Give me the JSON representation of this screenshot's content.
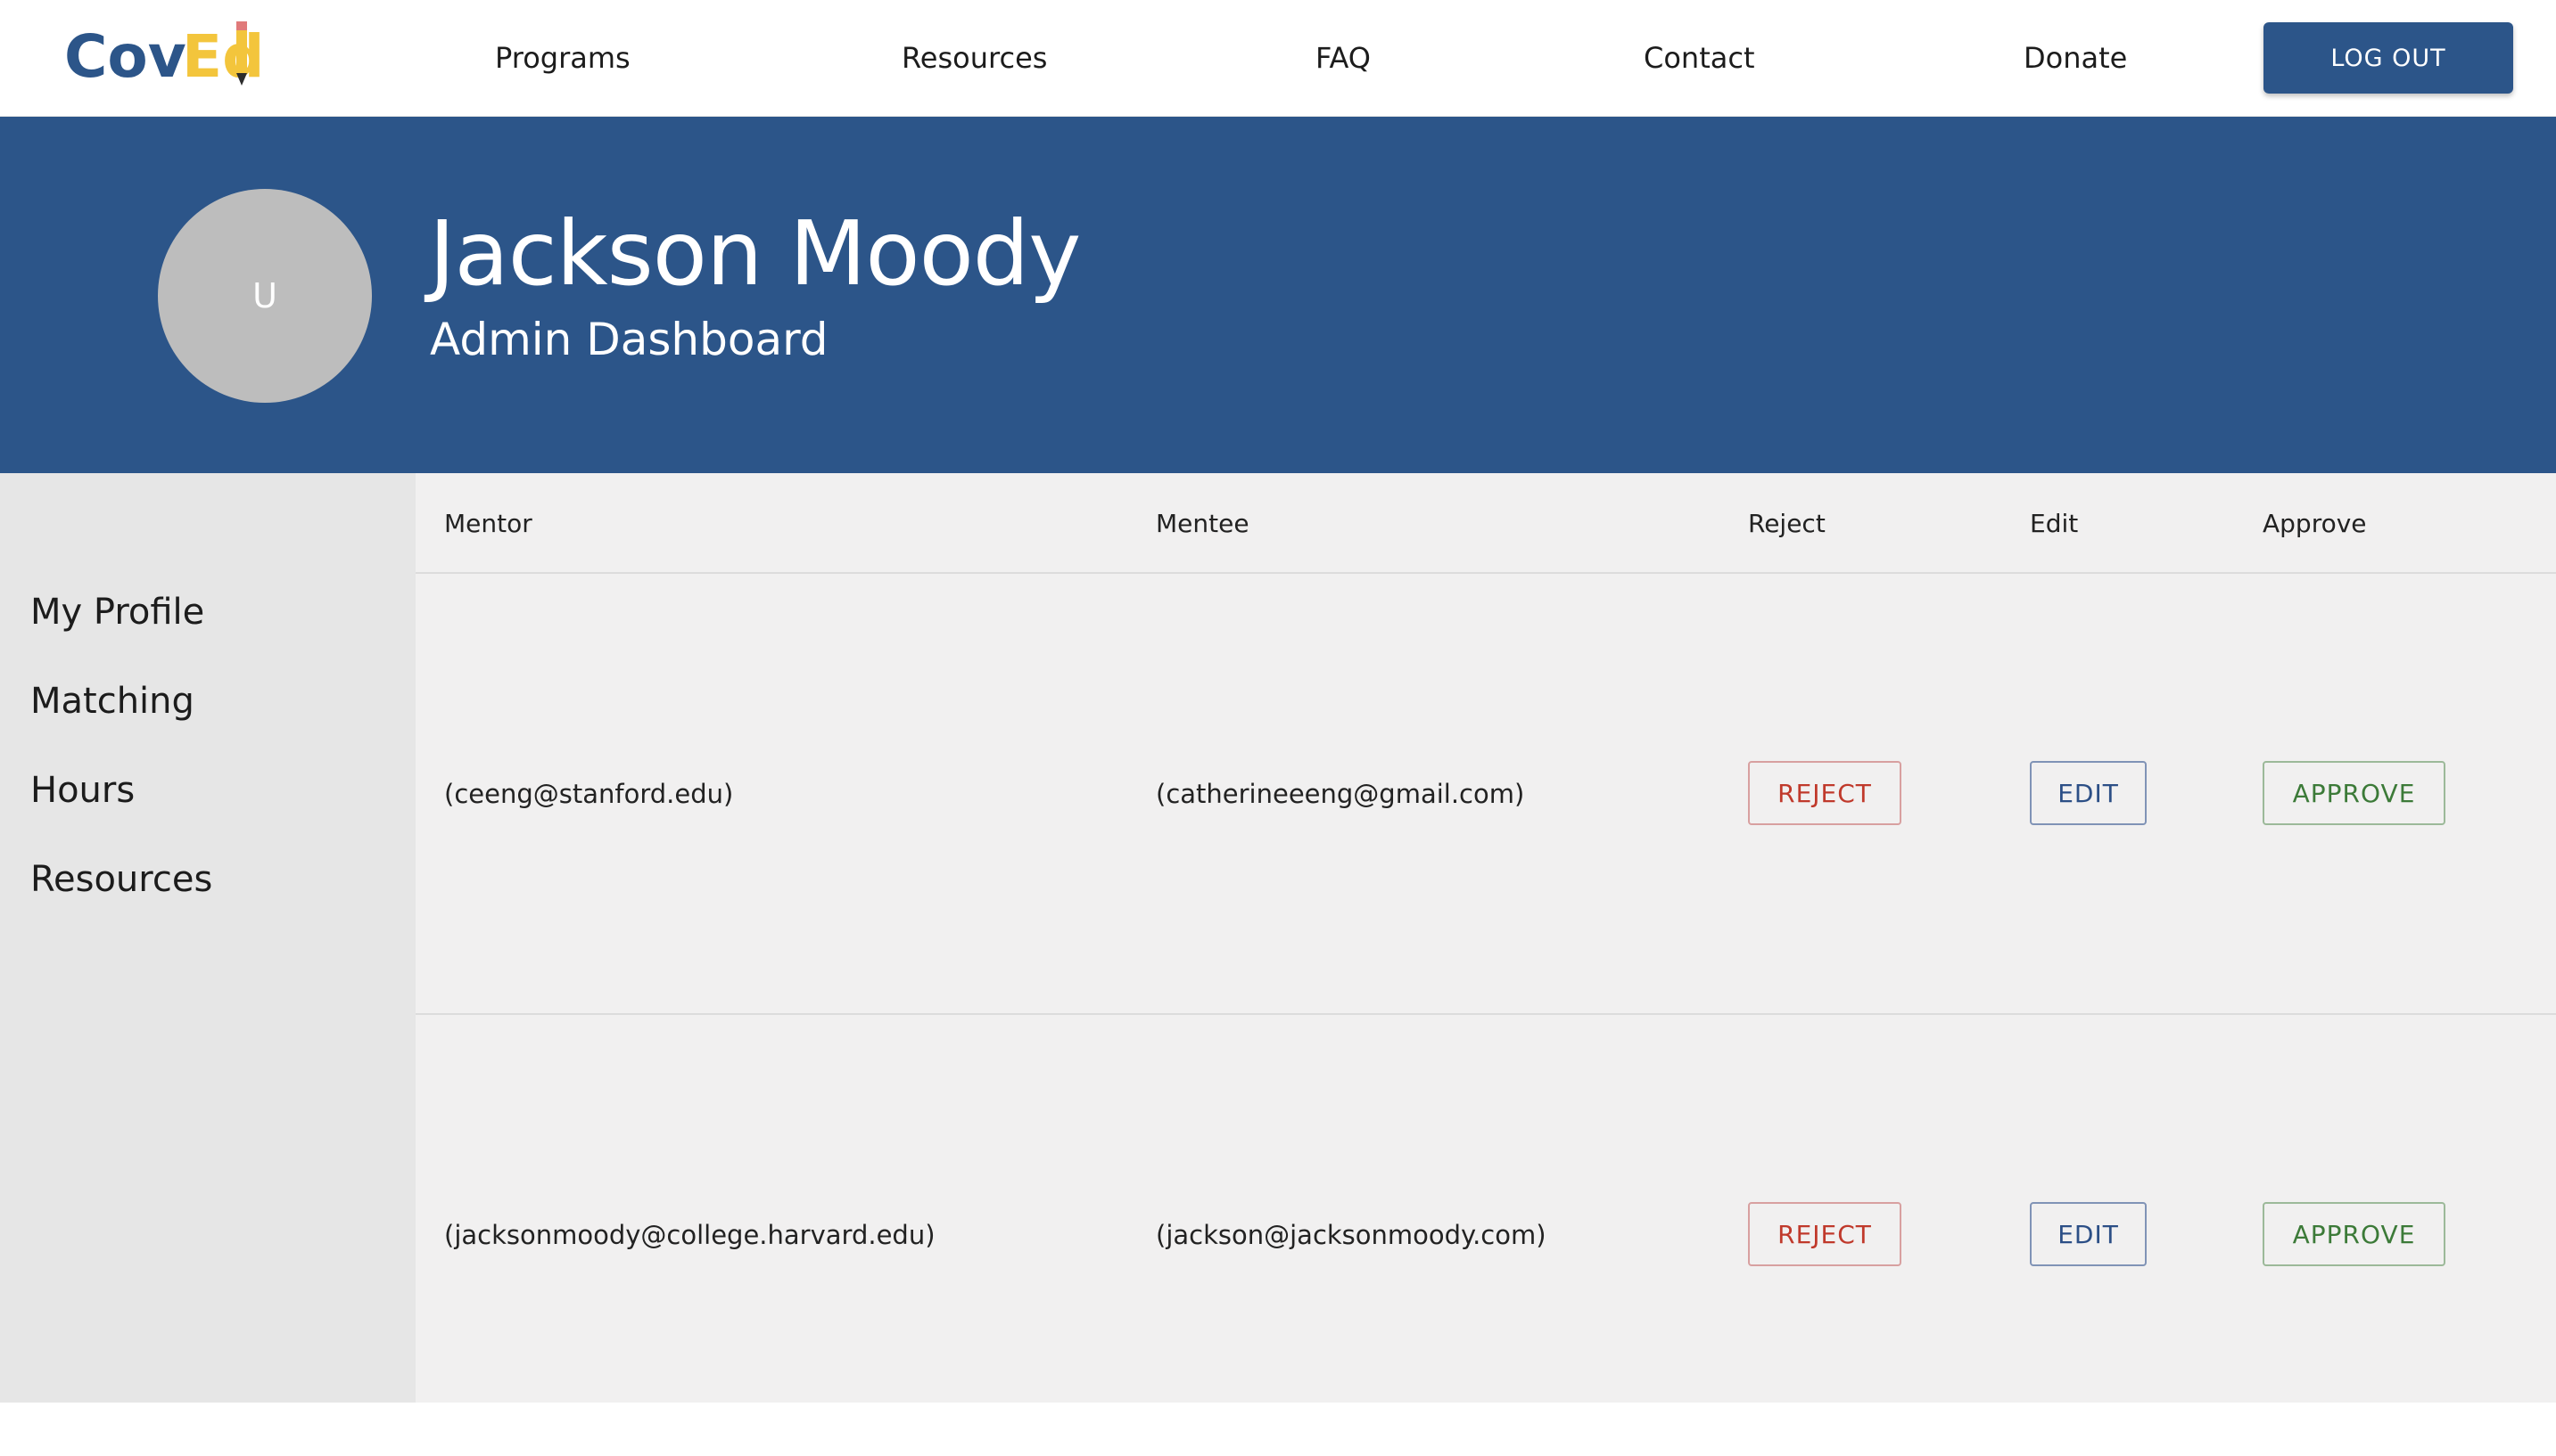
{
  "nav": {
    "logo_text_left": "Cov",
    "logo_text_right": "Ed",
    "links": [
      "Programs",
      "Resources",
      "FAQ",
      "Contact",
      "Donate"
    ],
    "logout_label": "LOG OUT"
  },
  "profile": {
    "avatar_initial": "U",
    "name": "Jackson Moody",
    "role": "Admin Dashboard"
  },
  "sidebar": {
    "items": [
      "My Profile",
      "Matching",
      "Hours",
      "Resources"
    ]
  },
  "table": {
    "headers": {
      "mentor": "Mentor",
      "mentee": "Mentee",
      "reject": "Reject",
      "edit": "Edit",
      "approve": "Approve"
    },
    "rows": [
      {
        "mentor": "(ceeng@stanford.edu)",
        "mentee": "(catherineeeng@gmail.com)",
        "reject_label": "REJECT",
        "edit_label": "EDIT",
        "approve_label": "APPROVE"
      },
      {
        "mentor": "(jacksonmoody@college.harvard.edu)",
        "mentee": "(jackson@jacksonmoody.com)",
        "reject_label": "REJECT",
        "edit_label": "EDIT",
        "approve_label": "APPROVE"
      }
    ]
  },
  "colors": {
    "brand_blue": "#2c5589",
    "logo_yellow": "#f3c53c",
    "reject_red": "#c0392b",
    "edit_blue": "#2c4f86",
    "approve_green": "#3c7a38"
  }
}
